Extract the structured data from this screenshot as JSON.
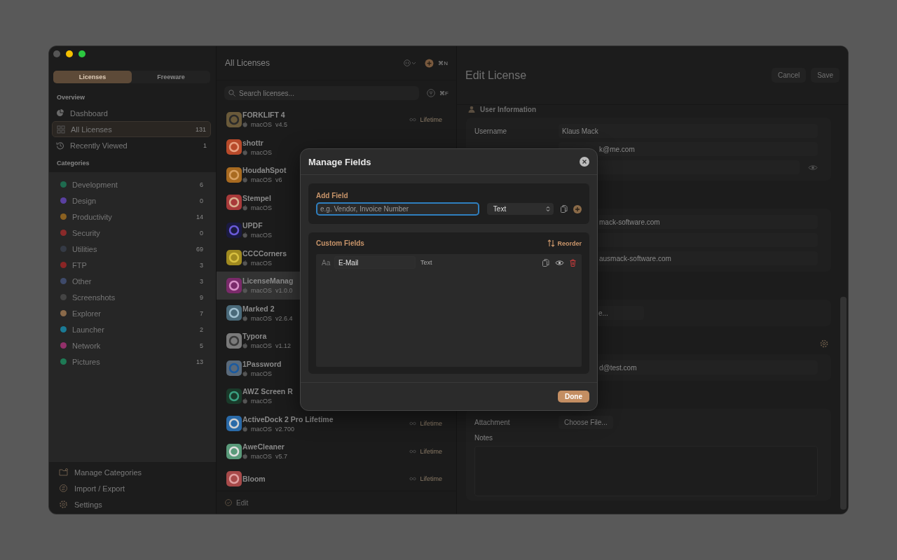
{
  "sidebar": {
    "segments": [
      {
        "label": "Licenses",
        "selected": true
      },
      {
        "label": "Freeware",
        "selected": false
      }
    ],
    "overview_heading": "Overview",
    "overview": [
      {
        "label": "Dashboard",
        "selected": false
      },
      {
        "label": "All Licenses",
        "count": "131",
        "selected": true
      },
      {
        "label": "Recently Viewed",
        "count": "1",
        "selected": false
      }
    ],
    "categories_heading": "Categories",
    "categories": [
      {
        "label": "Development",
        "count": "6",
        "color": "#1e6b4f"
      },
      {
        "label": "Design",
        "count": "0",
        "color": "#5a40a0"
      },
      {
        "label": "Productivity",
        "count": "14",
        "color": "#8a6020"
      },
      {
        "label": "Security",
        "count": "0",
        "color": "#8a2a2a"
      },
      {
        "label": "Utilities",
        "count": "69",
        "color": "#353a45"
      },
      {
        "label": "FTP",
        "count": "3",
        "color": "#8a2525"
      },
      {
        "label": "Other",
        "count": "3",
        "color": "#3e4a6a"
      },
      {
        "label": "Screenshots",
        "count": "9",
        "color": "#444444"
      },
      {
        "label": "Explorer",
        "count": "7",
        "color": "#8a6a4a"
      },
      {
        "label": "Launcher",
        "count": "2",
        "color": "#1a7a95"
      },
      {
        "label": "Network",
        "count": "5",
        "color": "#93306a"
      },
      {
        "label": "Pictures",
        "count": "13",
        "color": "#1e7a55"
      }
    ],
    "footer": [
      {
        "label": "Manage Categories"
      },
      {
        "label": "Import / Export"
      },
      {
        "label": "Settings"
      }
    ]
  },
  "list": {
    "title": "All Licenses",
    "new_shortcut": "⌘N",
    "search": {
      "placeholder": "Search licenses...",
      "shortcut": "⌘F"
    },
    "items": [
      {
        "name": "FORKLIFT 4",
        "platform": "macOS",
        "version": "v4.5",
        "license": "Lifetime",
        "selected": false
      },
      {
        "name": "shottr",
        "platform": "macOS",
        "selected": false
      },
      {
        "name": "HoudahSpot",
        "platform": "macOS",
        "version": "v6",
        "selected": false
      },
      {
        "name": "Stempel",
        "platform": "macOS",
        "selected": false
      },
      {
        "name": "UPDF",
        "platform": "macOS",
        "selected": false
      },
      {
        "name": "CCCCorners",
        "platform": "macOS",
        "selected": false
      },
      {
        "name": "LicenseManag",
        "platform": "macOS",
        "version": "v1.0.0",
        "selected": true
      },
      {
        "name": "Marked 2",
        "platform": "macOS",
        "version": "v2.6.4",
        "selected": false
      },
      {
        "name": "Typora",
        "platform": "macOS",
        "version": "v1.12",
        "selected": false
      },
      {
        "name": "1Password",
        "platform": "macOS",
        "selected": false
      },
      {
        "name": "AWZ Screen R",
        "platform": "macOS",
        "selected": false
      },
      {
        "name": "ActiveDock 2 Pro Lifetime",
        "platform": "macOS",
        "version": "v2.700",
        "license": "Lifetime",
        "selected": false
      },
      {
        "name": "AweCleaner",
        "platform": "macOS",
        "version": "v5.7",
        "license": "Lifetime",
        "selected": false
      },
      {
        "name": "Bloom",
        "license": "Lifetime",
        "selected": false
      }
    ],
    "footer": "Edit"
  },
  "detail": {
    "title": "Edit License",
    "buttons": [
      "Cancel",
      "Save"
    ],
    "sections": [
      {
        "heading": "User Information",
        "rows": [
          {
            "kind": "text",
            "label": "Username",
            "value": "Klaus Mack"
          },
          {
            "kind": "partial",
            "value": "k@me.com"
          },
          {
            "kind": "secret"
          }
        ]
      },
      {
        "rows": [
          {
            "kind": "partial",
            "value": "mack-software.com"
          },
          {
            "kind": "partial"
          },
          {
            "kind": "partial",
            "value": "ausmack-software.com"
          }
        ]
      },
      {
        "rows": [
          {
            "kind": "partial-button",
            "value": "e..."
          }
        ]
      },
      {
        "settings_icon": true,
        "rows": [
          {
            "kind": "partial",
            "value": "d@test.com"
          }
        ]
      },
      {
        "rows": [
          {
            "kind": "button",
            "label": "Attachment",
            "value": "Choose File..."
          },
          {
            "kind": "notes",
            "label": "Notes"
          }
        ]
      }
    ]
  },
  "modal": {
    "title": "Manage Fields",
    "add_field": {
      "label": "Add Field",
      "placeholder": "e.g. Vendor, Invoice Number",
      "type": "Text"
    },
    "custom_fields": {
      "label": "Custom Fields",
      "reorder": "Reorder",
      "fields": [
        {
          "prefix": "Aa",
          "name": "E-Mail",
          "type": "Text"
        }
      ]
    },
    "done": "Done"
  }
}
